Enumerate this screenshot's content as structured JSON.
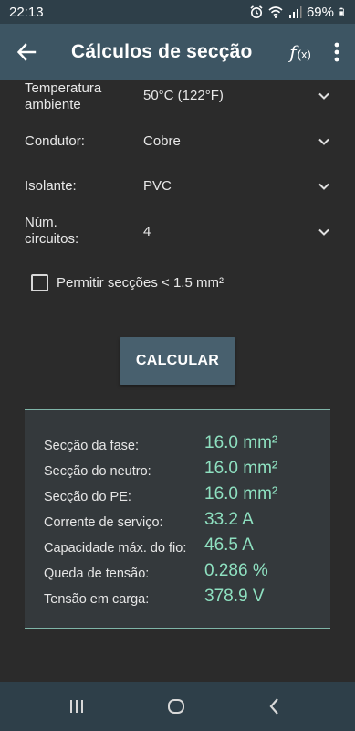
{
  "status_bar": {
    "time": "22:13",
    "battery": "69%",
    "icons": [
      "alarm-icon",
      "wifi-icon",
      "signal-icon",
      "battery-icon"
    ]
  },
  "app_bar": {
    "title": "Cálculos de secção",
    "back_icon": "arrow-left-icon",
    "fx_label": "f",
    "fx_sub": "(x)",
    "more_icon": "more-vertical-icon"
  },
  "form": {
    "rows": [
      {
        "label": "Temperatura ambiente",
        "value": "50°C (122°F)"
      },
      {
        "label": "Condutor:",
        "value": "Cobre"
      },
      {
        "label": "Isolante:",
        "value": "PVC"
      },
      {
        "label": "Núm. circuitos:",
        "value": "4"
      }
    ],
    "checkbox_label": "Permitir secções < 1.5 mm²",
    "checkbox_checked": false
  },
  "calc_button": "CALCULAR",
  "results": [
    {
      "label": "Secção da fase:",
      "value": "16.0 mm²"
    },
    {
      "label": "Secção do neutro:",
      "value": "16.0 mm²"
    },
    {
      "label": "Secção do PE:",
      "value": "16.0 mm²"
    },
    {
      "label": "Corrente de serviço:",
      "value": "33.2 A"
    },
    {
      "label": "Capacidade máx. do fio:",
      "value": "46.5 A"
    },
    {
      "label": "Queda de tensão:",
      "value": "0.286 %"
    },
    {
      "label": "Tensão em carga:",
      "value": "378.9 V"
    }
  ],
  "colors": {
    "background": "#2b2b2b",
    "app_bar": "#3d5563",
    "status_bar": "#2e3f49",
    "accent_value": "#8ee0c0",
    "panel_border": "#7fb5a8"
  },
  "nav_bar": {
    "buttons": [
      "recents-icon",
      "home-icon",
      "back-icon"
    ]
  }
}
